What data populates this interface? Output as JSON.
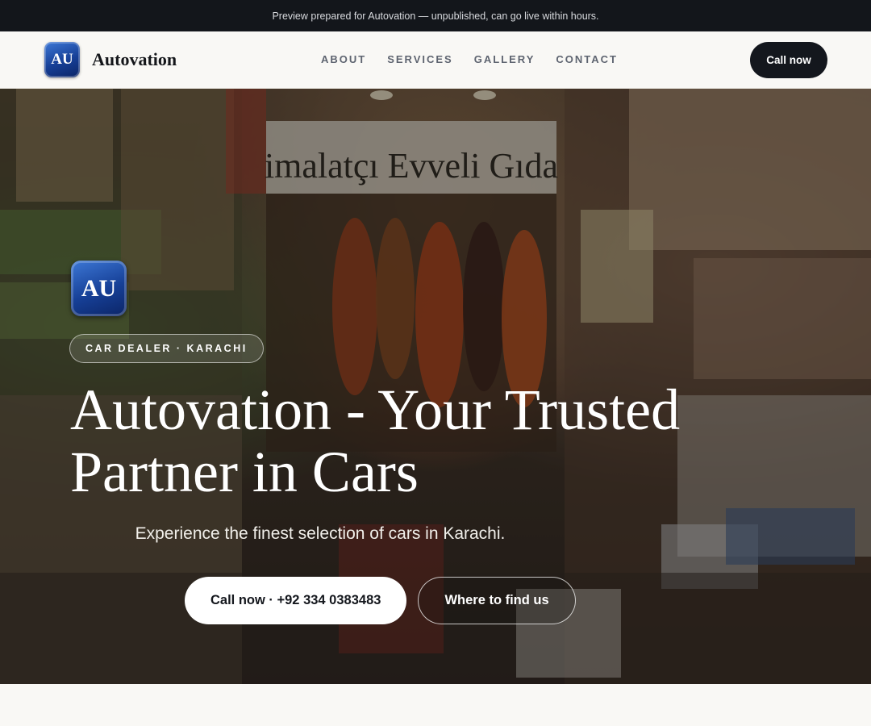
{
  "preview_bar": {
    "text": "Preview prepared for Autovation — unpublished, can go live within hours."
  },
  "nav": {
    "brand_badge": "AU",
    "brand_name": "Autovation",
    "links": [
      {
        "label": "ABOUT"
      },
      {
        "label": "SERVICES"
      },
      {
        "label": "GALLERY"
      },
      {
        "label": "CONTACT"
      }
    ],
    "cta_label": "Call now"
  },
  "hero": {
    "photo_sign_text": "imalatçı Evveli Gıda",
    "badge": "AU",
    "pill": "CAR DEALER · KARACHI",
    "title": "Autovation - Your Trusted Partner in Cars",
    "subtitle": "Experience the finest selection of cars in Karachi.",
    "primary_cta": "Call now · +92 334 0383483",
    "secondary_cta": "Where to find us"
  },
  "colors": {
    "preview_bar_bg": "#13161b",
    "nav_bg": "#f9f8f5",
    "dark_button": "#14171d",
    "badge_blue": "#163f96"
  }
}
